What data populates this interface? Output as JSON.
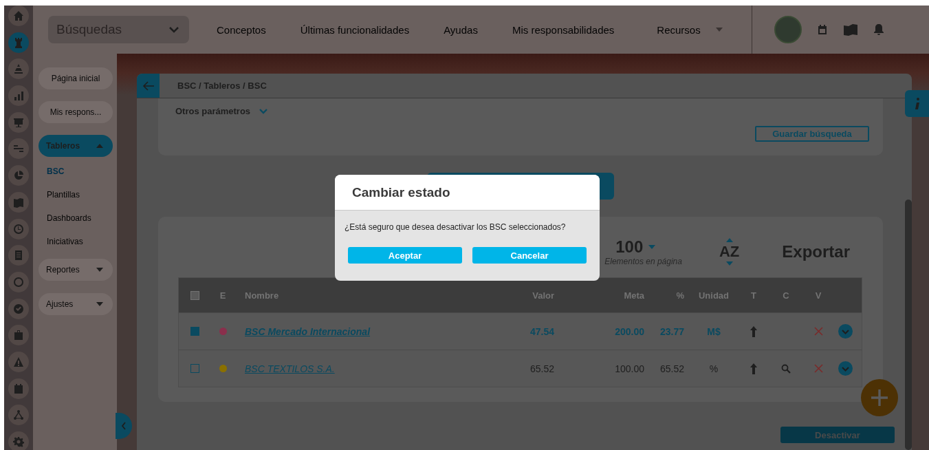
{
  "rail": [
    {
      "selected": false
    },
    {
      "selected": true
    },
    {
      "selected": false
    },
    {
      "selected": false
    },
    {
      "selected": false
    },
    {
      "selected": false
    },
    {
      "selected": false
    },
    {
      "selected": false
    },
    {
      "selected": false
    },
    {
      "selected": false
    },
    {
      "selected": false
    },
    {
      "selected": false
    },
    {
      "selected": false
    },
    {
      "selected": false
    },
    {
      "selected": false
    },
    {
      "selected": false
    },
    {
      "selected": false
    }
  ],
  "search": {
    "value": "Búsquedas"
  },
  "nav": [
    {
      "label": "Conceptos",
      "dropdown": false
    },
    {
      "label": "Últimas funcionalidades",
      "dropdown": false
    },
    {
      "label": "Ayudas",
      "dropdown": false
    },
    {
      "label": "Mis responsabilidades",
      "dropdown": false
    },
    {
      "label": "Recursos",
      "dropdown": true
    }
  ],
  "sidebar": {
    "items": [
      {
        "label": "Página inicial",
        "kind": "pill"
      },
      {
        "label": "Mis respons...",
        "kind": "pill"
      },
      {
        "label": "Tableros",
        "kind": "group",
        "expanded": true,
        "children": [
          {
            "label": "BSC",
            "selected": true
          },
          {
            "label": "Plantillas",
            "selected": false
          },
          {
            "label": "Dashboards",
            "selected": false
          },
          {
            "label": "Iniciativas",
            "selected": false
          }
        ]
      },
      {
        "label": "Reportes",
        "kind": "group",
        "expanded": false
      },
      {
        "label": "Ajustes",
        "kind": "group",
        "expanded": false
      }
    ]
  },
  "breadcrumb": "BSC / Tableros / BSC",
  "filters": {
    "title": "Otros parámetros",
    "expanded": false,
    "save_button": "Guardar búsqueda"
  },
  "results": {
    "page_size": "100",
    "page_size_label": "Elementos en página",
    "sort_label": "AZ",
    "export_label": "Exportar"
  },
  "table": {
    "select_all_checked": false,
    "columns": [
      "E",
      "Nombre",
      "Valor",
      "Meta",
      "%",
      "Unidad",
      "T",
      "C",
      "V"
    ],
    "rows": [
      {
        "selected": true,
        "color": "#8a2f4c",
        "name": "BSC Mercado Internacional",
        "valor": "47.54",
        "meta": "200.00",
        "pct": "23.77",
        "unidad": "M$",
        "c_icon": false
      },
      {
        "selected": false,
        "color": "#8a7000",
        "name": "BSC TEXTILOS S.A.",
        "valor": "65.52",
        "meta": "100.00",
        "pct": "65.52",
        "unidad": "%",
        "c_icon": true
      }
    ]
  },
  "deactivate_button": "Desactivar",
  "modal": {
    "title": "Cambiar estado",
    "message": "¿Está seguro que desea desactivar los BSC seleccionados?",
    "buttons": [
      "Aceptar",
      "Cancelar"
    ]
  }
}
